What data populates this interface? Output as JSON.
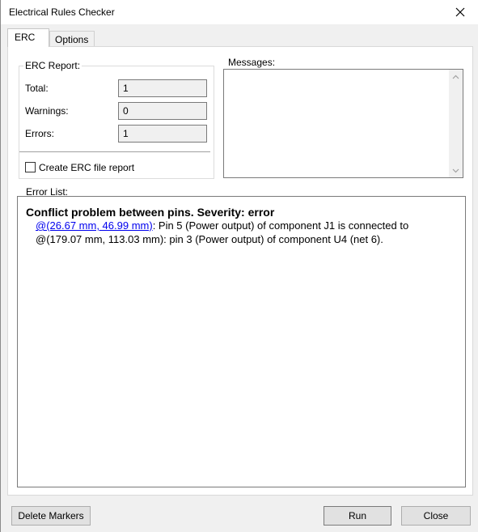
{
  "window": {
    "title": "Electrical Rules Checker"
  },
  "tabs": [
    {
      "label": "ERC",
      "active": true
    },
    {
      "label": "Options",
      "active": false
    }
  ],
  "erc_report": {
    "label": "ERC Report:",
    "total_label": "Total:",
    "total_value": "1",
    "warnings_label": "Warnings:",
    "warnings_value": "0",
    "errors_label": "Errors:",
    "errors_value": "1",
    "create_file_report_label": "Create ERC file report",
    "create_file_report_checked": false
  },
  "messages": {
    "label": "Messages:",
    "content": ""
  },
  "error_list": {
    "label": "Error List:",
    "items": [
      {
        "title": "Conflict problem between pins. Severity: error",
        "location1_link": "@(26.67 mm, 46.99 mm)",
        "line1_text": ": Pin 5 (Power output) of component J1 is connected to",
        "line2_text": "@(179.07 mm, 113.03 mm): pin 3 (Power output) of component U4 (net 6)."
      }
    ]
  },
  "buttons": {
    "delete_markers": "Delete Markers",
    "run": "Run",
    "close": "Close"
  },
  "icons": {
    "close": "close-icon",
    "scroll_up": "chevron-up-icon",
    "scroll_down": "chevron-down-icon"
  }
}
